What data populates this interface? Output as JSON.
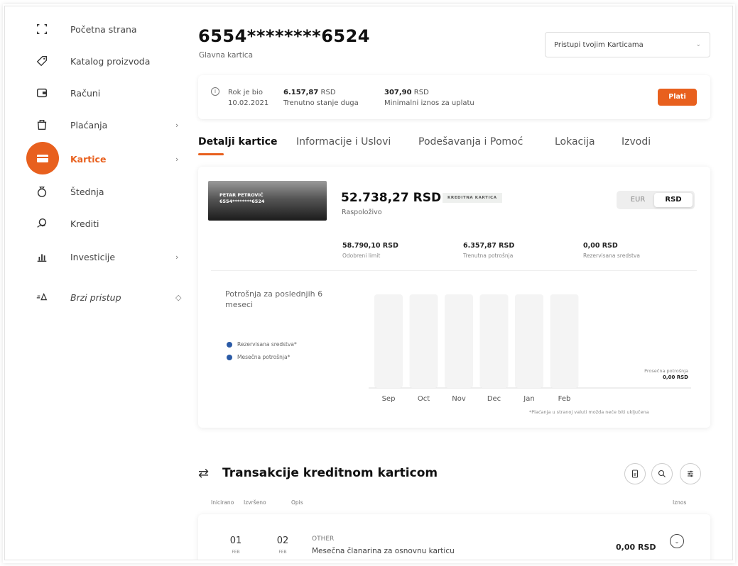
{
  "sidebar": {
    "items": [
      {
        "label": "Početna strana",
        "icon": "home-icon",
        "chevron": ""
      },
      {
        "label": "Katalog proizvoda",
        "icon": "tag-icon",
        "chevron": ""
      },
      {
        "label": "Računi",
        "icon": "wallet-icon",
        "chevron": ""
      },
      {
        "label": "Plaćanja",
        "icon": "payment-icon",
        "chevron": "›"
      },
      {
        "label": "Kartice",
        "icon": "card-icon",
        "chevron": "›",
        "active": true
      },
      {
        "label": "Štednja",
        "icon": "savings-icon",
        "chevron": ""
      },
      {
        "label": "Krediti",
        "icon": "loan-icon",
        "chevron": ""
      },
      {
        "label": "Investicije",
        "icon": "chart-icon",
        "chevron": "›"
      },
      {
        "label": "Brzi pristup",
        "icon": "quick-access-icon",
        "chevron": "◇"
      }
    ]
  },
  "header": {
    "card_number": "6554********6524",
    "card_subtitle": "Glavna kartica",
    "dropdown_value": "Pristupi tvojim Karticama",
    "dropdown_chevron": "⌄"
  },
  "due": {
    "info_icon": "i",
    "deadline_label": "Rok je bio",
    "deadline_date": "10.02.2021",
    "debt_amount": "6.157,87",
    "debt_currency": "RSD",
    "debt_label": "Trenutno stanje duga",
    "min_amount": "307,90",
    "min_currency": "RSD",
    "min_label": "Minimalni iznos za uplatu",
    "pay_button": "Plati"
  },
  "tabs": [
    {
      "label": "Detalji kartice",
      "active": true
    },
    {
      "label": "Informacije i Uslovi"
    },
    {
      "label": "Podešavanja i Pomoć"
    },
    {
      "label": "Lokacija"
    },
    {
      "label": "Izvodi"
    }
  ],
  "card": {
    "holder_name": "PETAR PETROVIĆ",
    "holder_number": "6554********6524",
    "available_amount": "52.738,27 RSD",
    "available_label": "Raspoloživo",
    "type_badge": "KREDITNA KARTICA",
    "currency_options": [
      "EUR",
      "RSD"
    ],
    "selected_currency": "RSD",
    "stats": [
      {
        "value": "58.790,10 RSD",
        "label": "Odobreni limit"
      },
      {
        "value": "6.357,87 RSD",
        "label": "Trenutna potrošnja"
      },
      {
        "value": "0,00 RSD",
        "label": "Rezervisana sredstva"
      }
    ]
  },
  "spending": {
    "title": "Potrošnja za poslednjih 6 meseci",
    "legend": [
      "Rezervisana sredstva*",
      "Mesečna potrošnja*"
    ],
    "average_label": "Prosečna potrošnja",
    "average_value": "0,00 RSD",
    "footnote": "*Plaćanja u stranoj valuti možda neće biti uključena"
  },
  "chart_data": {
    "type": "bar",
    "categories": [
      "Sep",
      "Oct",
      "Nov",
      "Dec",
      "Jan",
      "Feb"
    ],
    "series": [
      {
        "name": "Rezervisana sredstva*",
        "values": [
          0,
          0,
          0,
          0,
          0,
          0
        ]
      },
      {
        "name": "Mesečna potrošnja*",
        "values": [
          0,
          0,
          0,
          0,
          0,
          0
        ]
      }
    ],
    "title": "Potrošnja za poslednjih 6 meseci",
    "legend_position": "left",
    "colors": {
      "bar_placeholder": "#f4f4f4",
      "series": "#2a5aa6"
    }
  },
  "transactions": {
    "title": "Transakcije kreditnom karticom",
    "columns": [
      "Inicirano",
      "Izvršeno",
      "Opis",
      "Iznos"
    ],
    "rows": [
      {
        "initiated_day": "01",
        "initiated_month": "FEB",
        "executed_day": "02",
        "executed_month": "FEB",
        "category": "OTHER",
        "description": "Mesečna članarina za osnovnu karticu",
        "amount": "0,00 RSD"
      }
    ]
  },
  "colors": {
    "accent": "#e8601e",
    "legend_dot": "#2a5aa6"
  }
}
